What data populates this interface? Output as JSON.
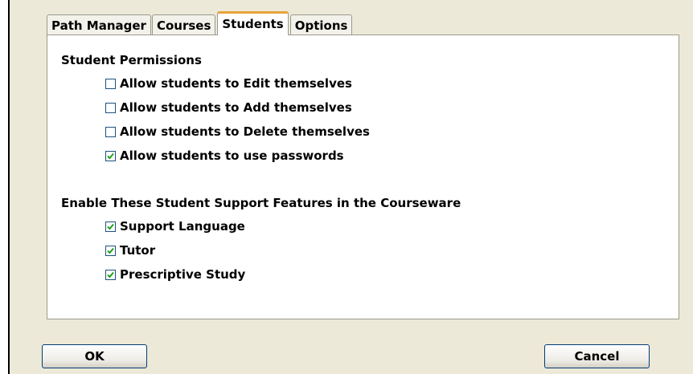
{
  "tabs": [
    {
      "label": "Path Manager",
      "active": false
    },
    {
      "label": "Courses",
      "active": false
    },
    {
      "label": "Students",
      "active": true
    },
    {
      "label": "Options",
      "active": false
    }
  ],
  "permissions": {
    "title": "Student Permissions",
    "items": [
      {
        "label": "Allow students to Edit themselves",
        "checked": false
      },
      {
        "label": "Allow students to Add themselves",
        "checked": false
      },
      {
        "label": "Allow students to Delete themselves",
        "checked": false
      },
      {
        "label": "Allow students to use passwords",
        "checked": true
      }
    ]
  },
  "support": {
    "title": "Enable These Student Support Features in the Courseware",
    "items": [
      {
        "label": "Support Language",
        "checked": true
      },
      {
        "label": "Tutor",
        "checked": true
      },
      {
        "label": "Prescriptive Study",
        "checked": true
      }
    ]
  },
  "buttons": {
    "ok": "OK",
    "cancel": "Cancel"
  },
  "colors": {
    "checkmark": "#21a121",
    "active_tab_accent": "#e8a33c"
  }
}
